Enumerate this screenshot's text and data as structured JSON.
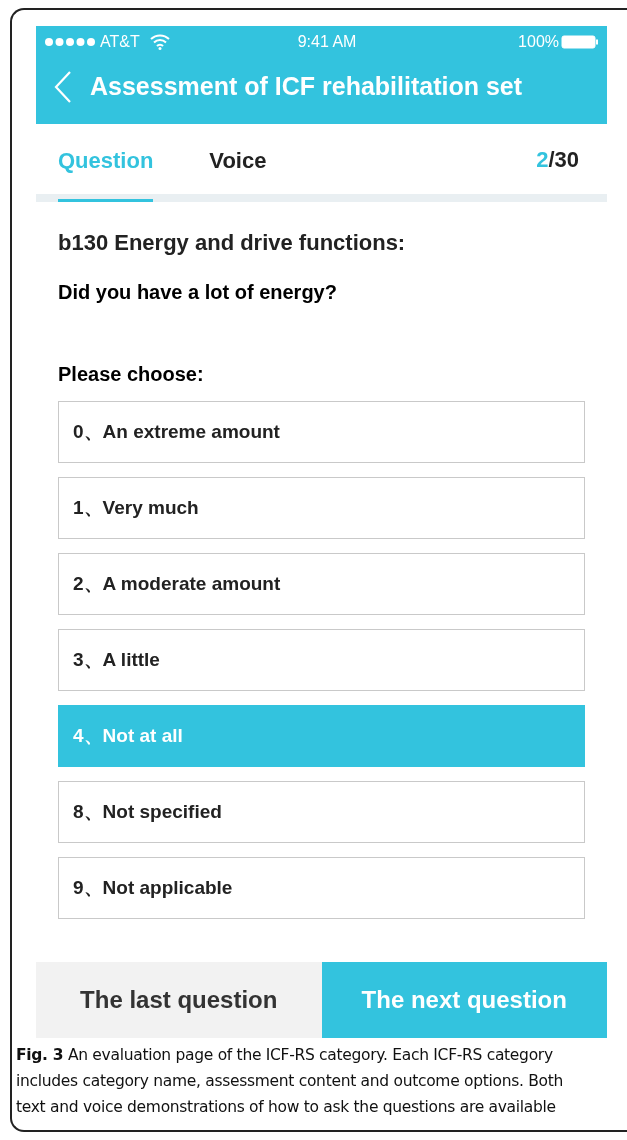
{
  "status_bar": {
    "carrier": "AT&T",
    "time": "9:41 AM",
    "battery": "100%"
  },
  "header": {
    "title": "Assessment of ICF rehabilitation set"
  },
  "tabs": [
    {
      "label": "Question",
      "selected": true
    },
    {
      "label": "Voice",
      "selected": false
    }
  ],
  "counter": {
    "current": "2",
    "total": "/30"
  },
  "category": "b130 Energy and drive functions:",
  "question": "Did you have a lot of energy?",
  "prompt": "Please choose:",
  "options": [
    {
      "label": "0、An extreme amount",
      "selected": false
    },
    {
      "label": "1、Very much",
      "selected": false
    },
    {
      "label": "2、A moderate amount",
      "selected": false
    },
    {
      "label": "3、A little",
      "selected": false
    },
    {
      "label": "4、Not at all",
      "selected": true
    },
    {
      "label": "8、Not specified",
      "selected": false
    },
    {
      "label": "9、Not applicable",
      "selected": false
    }
  ],
  "buttons": [
    {
      "label": "The last question",
      "kind": "secondary"
    },
    {
      "label": "The next question",
      "kind": "primary"
    }
  ],
  "caption": "**Fig. 3** An evaluation page of the ICF-RS category. Each ICF-RS category includes category name, assessment content and outcome options. Both text and voice demonstrations of how to ask the questions are available"
}
